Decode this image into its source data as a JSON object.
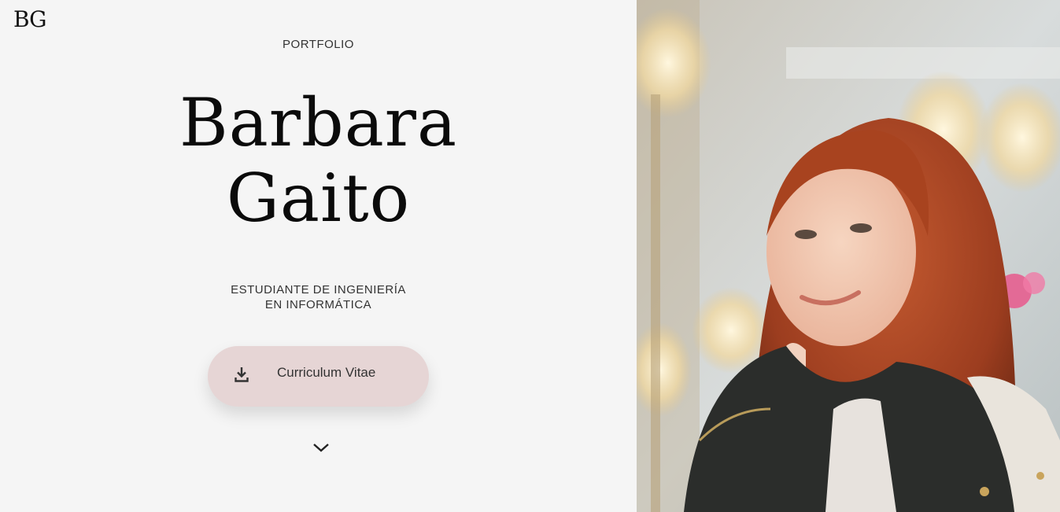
{
  "header": {
    "logo": "BG"
  },
  "hero": {
    "kicker": "PORTFOLIO",
    "name_line1": "Barbara",
    "name_line2": "Gaito",
    "role_line1": "ESTUDIANTE DE INGENIERÍA",
    "role_line2": "EN INFORMÁTICA",
    "cv_button_label": "Curriculum Vitae"
  },
  "icons": {
    "cv_button": "download-icon",
    "scroll": "chevron-down-icon"
  },
  "colors": {
    "background": "#f5f5f5",
    "button": "#e6d5d5",
    "hair_accent": "#b04a2a"
  }
}
